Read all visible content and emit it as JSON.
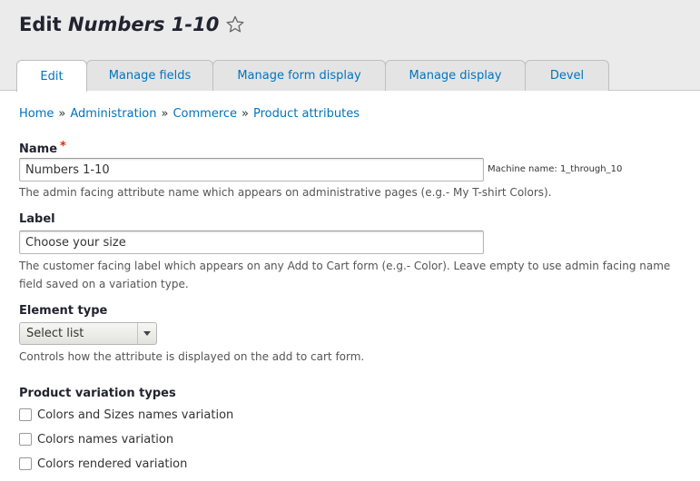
{
  "page": {
    "title_prefix": "Edit ",
    "title_entity": "Numbers 1-10",
    "favorite_icon": "star-icon"
  },
  "tabs": [
    {
      "label": "Edit",
      "active": true
    },
    {
      "label": "Manage fields",
      "active": false
    },
    {
      "label": "Manage form display",
      "active": false
    },
    {
      "label": "Manage display",
      "active": false
    },
    {
      "label": "Devel",
      "active": false
    }
  ],
  "breadcrumb": [
    {
      "label": "Home"
    },
    {
      "label": "Administration"
    },
    {
      "label": "Commerce"
    },
    {
      "label": "Product attributes"
    }
  ],
  "breadcrumb_separator": "»",
  "form": {
    "name": {
      "label": "Name",
      "required_marker": "*",
      "value": "Numbers 1-10",
      "machine_name": "Machine name: 1_through_10",
      "description": "The admin facing attribute name which appears on administrative pages (e.g.- My T-shirt Colors)."
    },
    "label": {
      "label": "Label",
      "value": "Choose your size",
      "description_line1": "The customer facing label which appears on any Add to Cart form (e.g.- Color). Leave empty to use admin facing name",
      "description_line2": "field saved on a variation type."
    },
    "element_type": {
      "label": "Element type",
      "selected": "Select list",
      "description": "Controls how the attribute is displayed on the add to cart form."
    },
    "variation_types": {
      "label": "Product variation types",
      "options": [
        {
          "label": "Colors and Sizes names variation",
          "checked": false
        },
        {
          "label": "Colors names variation",
          "checked": false
        },
        {
          "label": "Colors rendered variation",
          "checked": false
        }
      ]
    }
  },
  "colors": {
    "link": "#0074bd",
    "required": "#e62600",
    "header_bg": "#ebebeb"
  }
}
